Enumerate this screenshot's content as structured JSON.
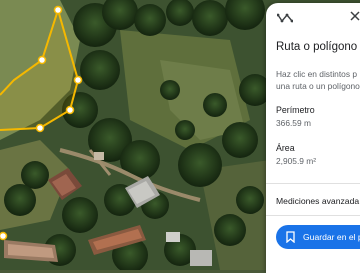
{
  "panel": {
    "ruler_icon": "ruler-icon",
    "close_icon": "close-icon",
    "title": "Ruta o polígono",
    "hint_line1": "Haz clic en distintos p",
    "hint_line2": "una ruta o un polígono",
    "perimeter_label": "Perímetro",
    "perimeter_value": "366.59 m",
    "area_label": "Área",
    "area_value": "2,905.9 m²",
    "advanced_label": "Mediciones avanzada",
    "save_label": "Guardar en el p",
    "save_icon": "bookmark-icon"
  },
  "colors": {
    "accent": "#1a73e8",
    "polygon": "#f5b800",
    "vertex": "#ffffff"
  }
}
